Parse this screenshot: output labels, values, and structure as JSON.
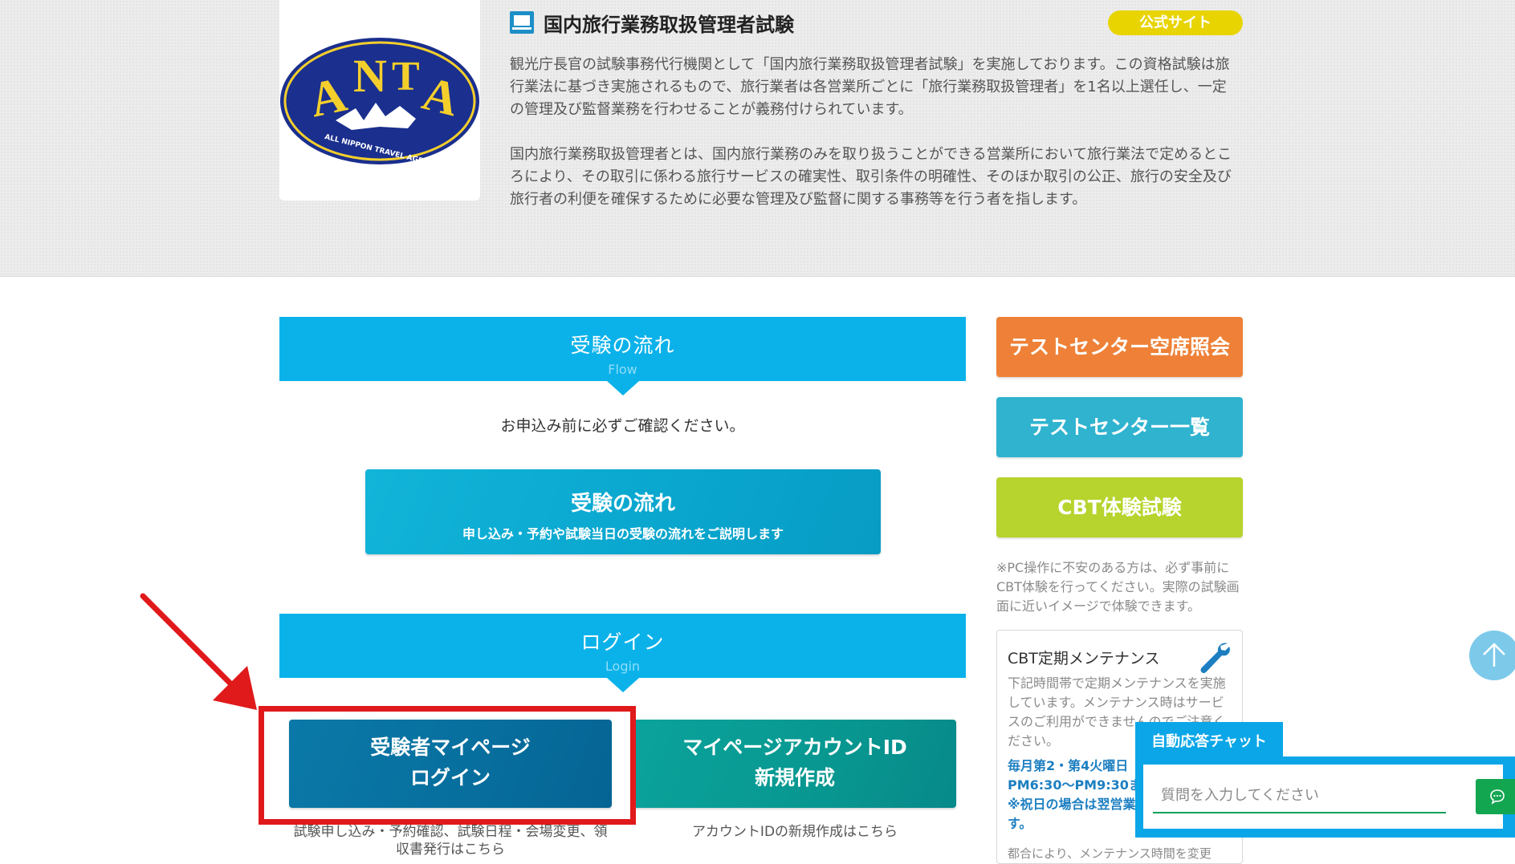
{
  "hero": {
    "title": "国内旅行業務取扱管理者試験",
    "official_badge": "公式サイト",
    "logo_alt": "ANTA",
    "description1": "観光庁長官の試験事務代行機関として「国内旅行業務取扱管理者試験」を実施しております。この資格試験は旅行業法に基づき実施されるもので、旅行業者は各営業所ごとに「旅行業務取扱管理者」を1名以上選任し、一定の管理及び監督業務を行わせることが義務付けられています。",
    "description2": "国内旅行業務取扱管理者とは、国内旅行業務のみを取り扱うことができる営業所において旅行業法で定めるところにより、その取引に係わる旅行サービスの確実性、取引条件の明確性、そのほか取引の公正、旅行の安全及び旅行者の利便を確保するために必要な管理及び監督に関する事務等を行う者を指します。"
  },
  "flow": {
    "header_jp": "受験の流れ",
    "header_en": "Flow",
    "notice": "お申込み前に必ずご確認ください。",
    "button_title": "受験の流れ",
    "button_sub": "申し込み・予約や試験当日の受験の流れをご説明します"
  },
  "login": {
    "header_jp": "ログイン",
    "header_en": "Login",
    "mypage_line1": "受験者マイページ",
    "mypage_line2": "ログイン",
    "mypage_sub": "試験申し込み・予約確認、試験日程・会場変更、領収書発行はこちら",
    "new_line1": "マイページアカウントID",
    "new_line2": "新規作成",
    "new_sub": "アカウントIDの新規作成はこちら"
  },
  "sidebar": {
    "btn_vacancy": "テストセンター空席照会",
    "btn_list": "テストセンター一覧",
    "btn_cbt": "CBT体験試験",
    "note": "※PC操作に不安のある方は、必ず事前にCBT体験を行ってください。実際の試験画面に近いイメージで体験できます。",
    "maint_title": "CBT定期メンテナンス",
    "maint_desc": "下記時間帯で定期メンテナンスを実施しています。メンテナンス時はサービスのご利用ができませんのでご注意ください。",
    "maint_line1": "毎月第2・第4火曜日",
    "maint_line2": "PM6:30〜PM9:30まで",
    "maint_line3": "※祝日の場合は翌営業日に実施します。",
    "maint_more": "都合により、メンテナンス時間を変更"
  },
  "chat": {
    "tab_label": "自動応答チャット",
    "placeholder": "質問を入力してください"
  },
  "colors": {
    "primary_blue": "#0bb2ea",
    "orange": "#ee8137",
    "teal": "#2fb3cf",
    "lime": "#b6d42d",
    "badge_yellow": "#e8d400",
    "highlight_red": "#e0191b",
    "chat_green": "#13a651"
  }
}
